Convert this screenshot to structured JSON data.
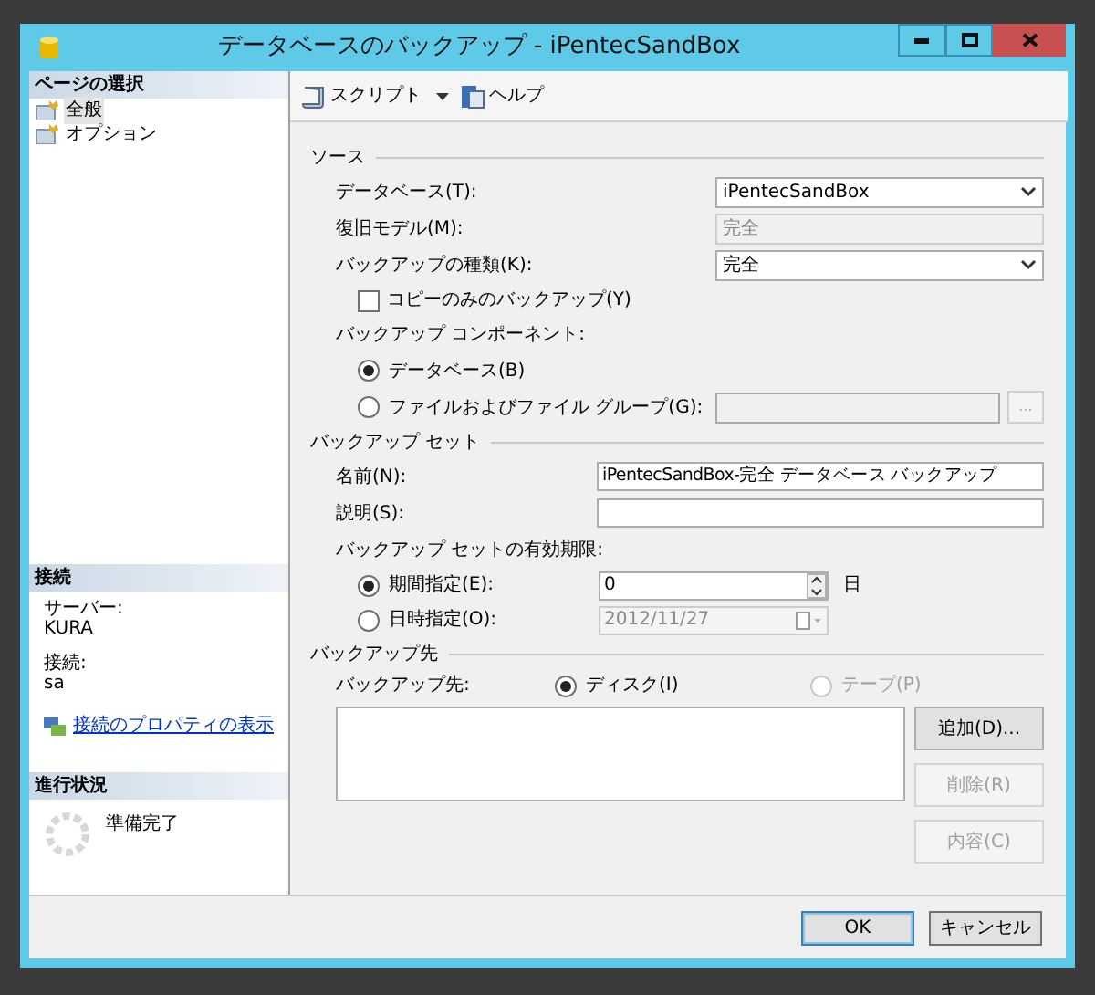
{
  "window": {
    "title": "データベースのバックアップ - iPentecSandBox"
  },
  "sidebar": {
    "header": "ページの選択",
    "items": [
      {
        "label": "全般",
        "selected": true
      },
      {
        "label": "オプション",
        "selected": false
      }
    ]
  },
  "connection": {
    "header": "接続",
    "fields": [
      {
        "label": "サーバー:",
        "value": "KURA"
      },
      {
        "label": "接続:",
        "value": "sa"
      }
    ],
    "link": "接続のプロパティの表示"
  },
  "progress": {
    "header": "進行状況",
    "status": "準備完了"
  },
  "toolbar": [
    {
      "label": "スクリプト",
      "kind": "script",
      "dropdown": true
    },
    {
      "label": "ヘルプ",
      "kind": "help",
      "dropdown": false
    }
  ],
  "source": {
    "title": "ソース",
    "database": {
      "label": "データベース(T):",
      "value": "iPentecSandBox",
      "disabled": false
    },
    "recovery_model": {
      "label": "復旧モデル(M):",
      "value": "完全",
      "disabled": true
    },
    "backup_type": {
      "label": "バックアップの種類(K):",
      "value": "完全",
      "disabled": false
    },
    "copy_only": {
      "label": "コピーのみのバックアップ(Y)",
      "checked": false
    },
    "component_label": "バックアップ コンポーネント:",
    "components": [
      {
        "label": "データベース(B)",
        "selected": true
      },
      {
        "label": "ファイルおよびファイル グループ(G):",
        "selected": false
      }
    ],
    "browse_button": {
      "label": "...",
      "disabled": true
    }
  },
  "backup_set": {
    "title": "バックアップ セット",
    "name": {
      "label": "名前(N):",
      "value": "iPentecSandBox-完全 データベース バックアップ"
    },
    "description": {
      "label": "説明(S):"
    },
    "expiry_label": "バックアップ セットの有効期限:",
    "expiry": [
      {
        "label": "期間指定(E):",
        "selected": true,
        "value": "0",
        "unit": "日"
      },
      {
        "label": "日時指定(O):",
        "selected": false,
        "value": "2012/11/27"
      }
    ]
  },
  "destination": {
    "title": "バックアップ先",
    "label": "バックアップ先:",
    "media": [
      {
        "label": "ディスク(I)",
        "selected": true,
        "disabled": false
      },
      {
        "label": "テープ(P)",
        "selected": false,
        "disabled": true
      }
    ],
    "buttons": [
      {
        "label": "追加(D)...",
        "disabled": false
      },
      {
        "label": "削除(R)",
        "disabled": true
      },
      {
        "label": "内容(C)",
        "disabled": true
      }
    ]
  },
  "footer_buttons": [
    {
      "label": "OK",
      "default": true
    },
    {
      "label": "キャンセル",
      "default": false
    }
  ]
}
